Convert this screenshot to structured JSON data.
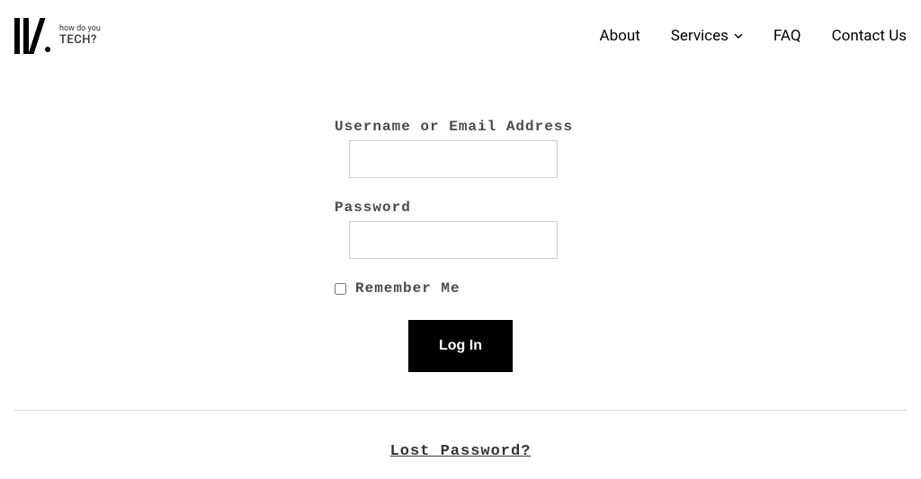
{
  "logo": {
    "line1": "how do you",
    "line2": "TECH?"
  },
  "nav": {
    "about": "About",
    "services": "Services",
    "faq": "FAQ",
    "contact": "Contact Us"
  },
  "form": {
    "username_label": "Username or Email Address",
    "username_value": "",
    "password_label": "Password",
    "password_value": "",
    "remember_label": "Remember Me",
    "login_button": "Log In"
  },
  "footer": {
    "lost_password": "Lost Password?"
  }
}
